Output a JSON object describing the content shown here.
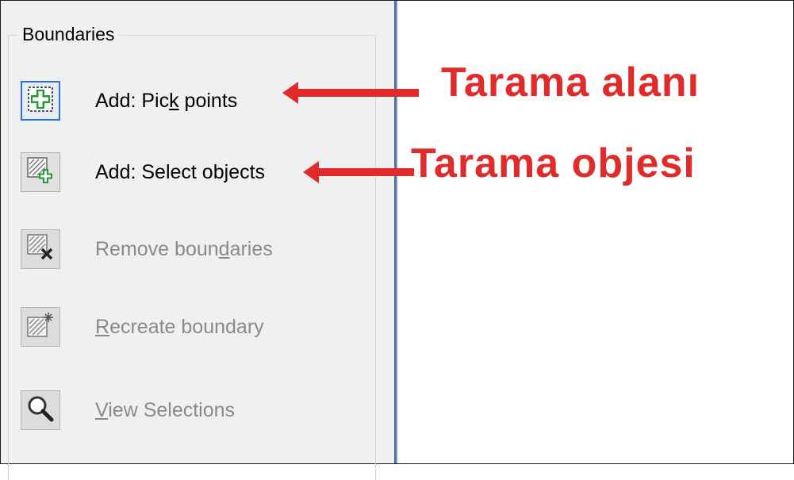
{
  "boundaries": {
    "title": "Boundaries",
    "items": [
      {
        "label_pre": "Add: Pic",
        "label_key": "k",
        "label_post": " points",
        "icon": "pick-points-icon",
        "state": "active"
      },
      {
        "label_pre": "Add: Select ob",
        "label_key": "j",
        "label_post": "ects",
        "icon": "select-objects-icon",
        "state": "enabled"
      },
      {
        "label_pre": "Remove boun",
        "label_key": "d",
        "label_post": "aries",
        "icon": "remove-boundaries-icon",
        "state": "disabled"
      },
      {
        "label_pre": "",
        "label_key": "R",
        "label_post": "ecreate boundary",
        "icon": "recreate-boundary-icon",
        "state": "disabled"
      },
      {
        "label_pre": "",
        "label_key": "V",
        "label_post": "iew Selections",
        "icon": "view-selections-icon",
        "state": "disabled"
      }
    ]
  },
  "annotations": {
    "first": "Tarama alanı",
    "second": "Tarama objesi",
    "color": "#e12b2b"
  },
  "colors": {
    "accent": "#2f6fd6",
    "add_green": "#1e9e2e"
  }
}
